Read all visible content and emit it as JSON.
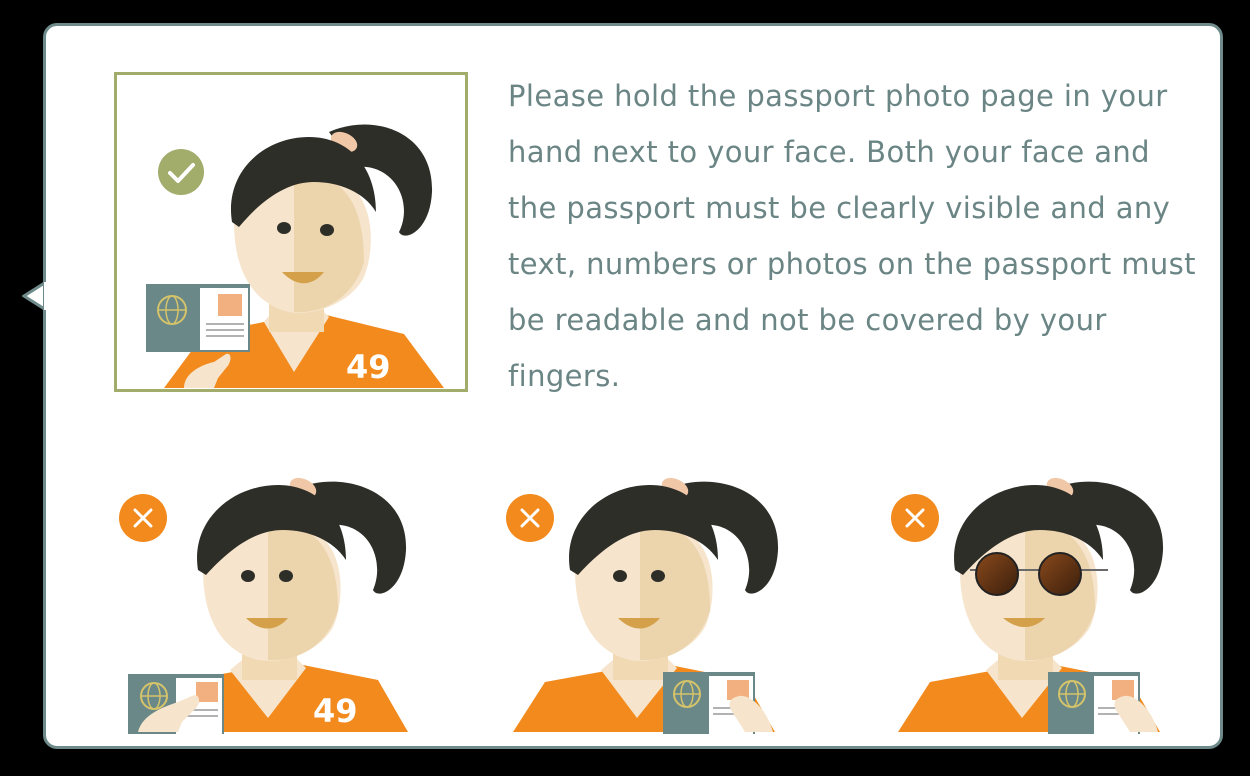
{
  "instructions": {
    "text": "Please hold the passport photo page in your hand next to your face. Both your face and the passport must be clearly visible and any text, numbers or photos on the passport must be readable and not be covered by your fingers."
  },
  "examples": [
    {
      "status": "correct",
      "icon": "check-icon",
      "jersey_number": "49"
    },
    {
      "status": "incorrect",
      "icon": "x-icon",
      "jersey_number": "49"
    },
    {
      "status": "incorrect",
      "icon": "x-icon"
    },
    {
      "status": "incorrect",
      "icon": "x-icon"
    }
  ],
  "colors": {
    "frame_border": "#6e8a8a",
    "text": "#6b8585",
    "correct": "#a2ad6c",
    "incorrect": "#f28a1e",
    "jersey": "#f28a1e",
    "hair": "#2e2e29",
    "passport": "#6a8888"
  }
}
